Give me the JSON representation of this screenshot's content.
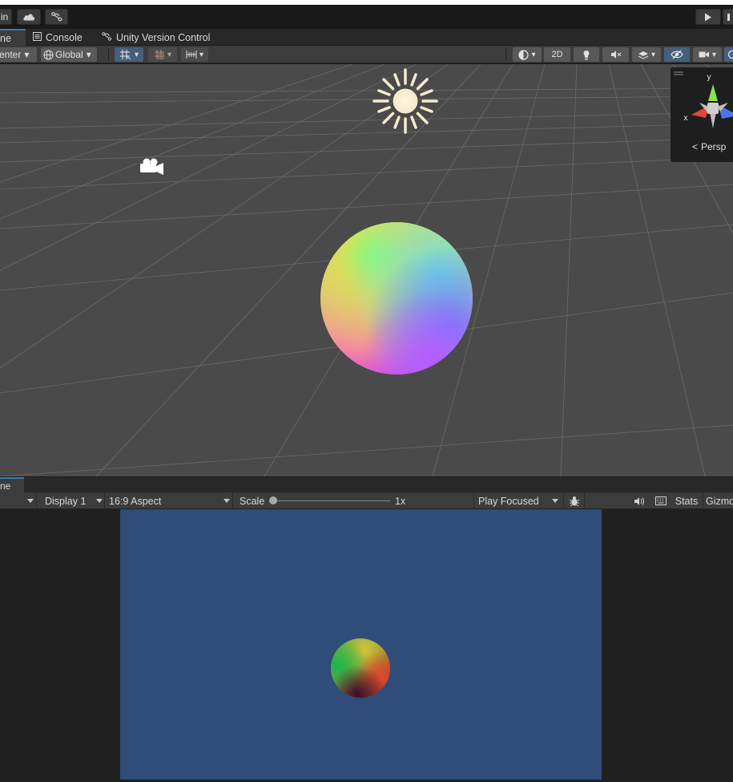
{
  "toolbar": {
    "account_label": "in",
    "cloud_icon": "cloud-icon",
    "collab_icon": "version-control-icon",
    "play_icon": "play-icon"
  },
  "tabs": [
    {
      "label": "ne",
      "icon": "scene-icon"
    },
    {
      "label": "Console",
      "icon": "console-icon"
    },
    {
      "label": "Unity Version Control",
      "icon": "version-control-icon"
    }
  ],
  "scene_toolbar": {
    "pivot_label": "enter",
    "space_label": "Global",
    "mode_2d_label": "2D"
  },
  "scene": {
    "gizmo_y_label": "y",
    "gizmo_x_label": "x",
    "projection_label": "Persp",
    "colors": {
      "background": "#484848",
      "sun": "#fdf2d6"
    }
  },
  "game_view": {
    "tab_label": "ne",
    "display_label": "Display 1",
    "aspect_label": "16:9 Aspect",
    "scale_label": "Scale",
    "scale_value": "1x",
    "play_mode_label": "Play Focused",
    "stats_label": "Stats",
    "gizmos_label": "Gizmo",
    "background_color": "#304c78"
  }
}
